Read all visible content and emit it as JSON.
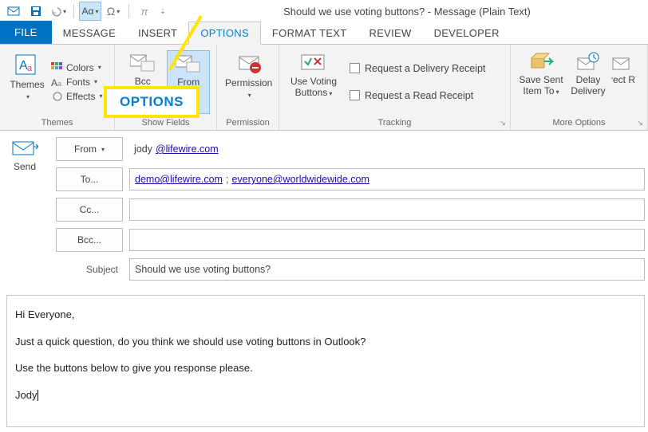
{
  "window": {
    "title": "Should we use voting buttons? - Message (Plain Text)"
  },
  "qat": {
    "save": "save-icon",
    "undo": "undo-icon",
    "font_toggle": "Aα",
    "omega": "Ω",
    "pi": "π"
  },
  "tabs": {
    "file": "FILE",
    "message": "MESSAGE",
    "insert": "INSERT",
    "options": "OPTIONS",
    "format_text": "FORMAT TEXT",
    "review": "REVIEW",
    "developer": "DEVELOPER"
  },
  "ribbon": {
    "themes": {
      "group_label": "Themes",
      "themes": "Themes",
      "colors": "Colors",
      "fonts": "Fonts",
      "effects": "Effects"
    },
    "show_fields": {
      "group_label": "Show Fields",
      "bcc": "Bcc",
      "from": "From"
    },
    "permission": {
      "group_label": "Permission",
      "permission": "Permission"
    },
    "tracking": {
      "group_label": "Tracking",
      "voting": "Use Voting Buttons",
      "delivery": "Request a Delivery Receipt",
      "read": "Request a Read Receipt"
    },
    "more": {
      "group_label": "More Options",
      "save_sent": "Save Sent Item To",
      "delay": "Delay Delivery",
      "direct": "Direct Rep"
    }
  },
  "compose": {
    "send": "Send",
    "from_btn": "From",
    "from_value_prefix": "jody",
    "from_value_domain": "@lifewire.com",
    "to_btn": "To...",
    "to_1": "demo@lifewire.com",
    "to_sep": ";",
    "to_2": "everyone@worldwidewide.com",
    "cc_btn": "Cc...",
    "bcc_btn": "Bcc...",
    "subject_label": "Subject",
    "subject_value": "Should we use voting buttons?"
  },
  "body": {
    "p1": "Hi Everyone,",
    "p2": "Just a quick question, do you think we should use voting buttons in Outlook?",
    "p3": "Use the buttons below to give you response please.",
    "p4": "Jody"
  },
  "callout": {
    "label": "OPTIONS"
  }
}
